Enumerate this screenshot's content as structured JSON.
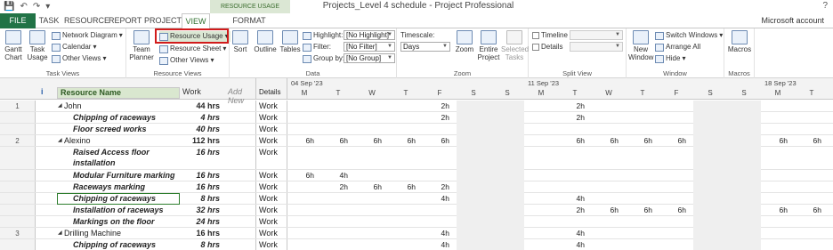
{
  "title_bar": {
    "qat_icons": [
      "save-icon",
      "undo-icon",
      "redo-icon",
      "customize-icon"
    ],
    "context_tab_group": "RESOURCE USAGE TOOLS",
    "app_title": "Projects_Level 4 schedule - Project Professional",
    "help": "?"
  },
  "tabs": {
    "file": "FILE",
    "task": "TASK",
    "resource": "RESOURCE",
    "report": "REPORT",
    "project": "PROJECT",
    "view": "VIEW",
    "format": "FORMAT",
    "account": "Microsoft account"
  },
  "ribbon": {
    "task_views": {
      "label": "Task Views",
      "gantt_chart": "Gantt Chart",
      "task_usage": "Task Usage",
      "network_diagram": "Network Diagram",
      "calendar": "Calendar",
      "other_views": "Other Views"
    },
    "resource_views": {
      "label": "Resource Views",
      "team_planner": "Team Planner",
      "resource_usage": "Resource Usage",
      "resource_sheet": "Resource Sheet",
      "other_views": "Other Views"
    },
    "data": {
      "label": "Data",
      "sort": "Sort",
      "outline": "Outline",
      "tables": "Tables",
      "highlight_label": "Highlight:",
      "highlight_value": "[No Highlight]",
      "filter_label": "Filter:",
      "filter_value": "[No Filter]",
      "groupby_label": "Group by:",
      "groupby_value": "[No Group]"
    },
    "zoom": {
      "label": "Zoom",
      "timescale_label": "Timescale:",
      "timescale_value": "Days",
      "zoom": "Zoom",
      "entire_project": "Entire Project",
      "selected_tasks": "Selected Tasks"
    },
    "split_view": {
      "label": "Split View",
      "timeline": "Timeline",
      "details": "Details"
    },
    "window": {
      "label": "Window",
      "new_window": "New Window",
      "switch_windows": "Switch Windows",
      "arrange_all": "Arrange All",
      "hide": "Hide"
    },
    "macros": {
      "label": "Macros",
      "macros": "Macros"
    }
  },
  "sheet": {
    "headers": {
      "info": "i",
      "resource_name": "Resource Name",
      "work": "Work",
      "add_new": "Add New",
      "details": "Details"
    },
    "weeks": [
      "04 Sep '23",
      "11 Sep '23",
      "18 Sep '23"
    ],
    "days": [
      "M",
      "T",
      "W",
      "T",
      "F",
      "S",
      "S",
      "M",
      "T",
      "W",
      "T",
      "F",
      "S",
      "S",
      "M",
      "T"
    ],
    "rows": [
      {
        "id": "1",
        "name": "John",
        "work": "44 hrs",
        "detail": "Work",
        "type": "resource",
        "cells": [
          "",
          "",
          "",
          "",
          "2h",
          "",
          "",
          "",
          "2h",
          "",
          "",
          "",
          "",
          "",
          "",
          ""
        ]
      },
      {
        "id": "",
        "name": "Chipping of raceways",
        "work": "4 hrs",
        "detail": "Work",
        "type": "assign",
        "cells": [
          "",
          "",
          "",
          "",
          "2h",
          "",
          "",
          "",
          "2h",
          "",
          "",
          "",
          "",
          "",
          "",
          ""
        ]
      },
      {
        "id": "",
        "name": "Floor screed works",
        "work": "40 hrs",
        "detail": "Work",
        "type": "assign",
        "cells": [
          "",
          "",
          "",
          "",
          "",
          "",
          "",
          "",
          "",
          "",
          "",
          "",
          "",
          "",
          "",
          ""
        ]
      },
      {
        "id": "2",
        "name": "Alexino",
        "work": "112 hrs",
        "detail": "Work",
        "type": "resource",
        "cells": [
          "6h",
          "6h",
          "6h",
          "6h",
          "6h",
          "",
          "",
          "",
          "6h",
          "6h",
          "6h",
          "6h",
          "",
          "",
          "6h",
          "6h"
        ]
      },
      {
        "id": "",
        "name": "Raised Access floor installation",
        "work": "16 hrs",
        "detail": "Work",
        "type": "assign",
        "cells": [
          "",
          "",
          "",
          "",
          "",
          "",
          "",
          "",
          "",
          "",
          "",
          "",
          "",
          "",
          "",
          ""
        ]
      },
      {
        "id": "",
        "name": "Modular Furniture marking",
        "work": "16 hrs",
        "detail": "Work",
        "type": "assign",
        "cells": [
          "6h",
          "4h",
          "",
          "",
          "",
          "",
          "",
          "",
          "",
          "",
          "",
          "",
          "",
          "",
          "",
          ""
        ]
      },
      {
        "id": "",
        "name": "Raceways marking",
        "work": "16 hrs",
        "detail": "Work",
        "type": "assign",
        "cells": [
          "",
          "2h",
          "6h",
          "6h",
          "2h",
          "",
          "",
          "",
          "",
          "",
          "",
          "",
          "",
          "",
          "",
          ""
        ]
      },
      {
        "id": "",
        "name": "Chipping of raceways",
        "work": "8 hrs",
        "detail": "Work",
        "type": "assign",
        "cells": [
          "",
          "",
          "",
          "",
          "4h",
          "",
          "",
          "",
          "4h",
          "",
          "",
          "",
          "",
          "",
          "",
          ""
        ]
      },
      {
        "id": "",
        "name": "Installation of raceways",
        "work": "32 hrs",
        "detail": "Work",
        "type": "assign",
        "cells": [
          "",
          "",
          "",
          "",
          "",
          "",
          "",
          "",
          "2h",
          "6h",
          "6h",
          "6h",
          "",
          "",
          "6h",
          "6h"
        ]
      },
      {
        "id": "",
        "name": "Markings on the floor",
        "work": "24 hrs",
        "detail": "Work",
        "type": "assign",
        "cells": [
          "",
          "",
          "",
          "",
          "",
          "",
          "",
          "",
          "",
          "",
          "",
          "",
          "",
          "",
          "",
          ""
        ]
      },
      {
        "id": "3",
        "name": "Drilling Machine",
        "work": "16 hrs",
        "detail": "Work",
        "type": "resource",
        "cells": [
          "",
          "",
          "",
          "",
          "4h",
          "",
          "",
          "",
          "4h",
          "",
          "",
          "",
          "",
          "",
          "",
          ""
        ]
      },
      {
        "id": "",
        "name": "Chipping of raceways",
        "work": "8 hrs",
        "detail": "Work",
        "type": "assign",
        "cells": [
          "",
          "",
          "",
          "",
          "4h",
          "",
          "",
          "",
          "4h",
          "",
          "",
          "",
          "",
          "",
          "",
          ""
        ]
      }
    ]
  }
}
